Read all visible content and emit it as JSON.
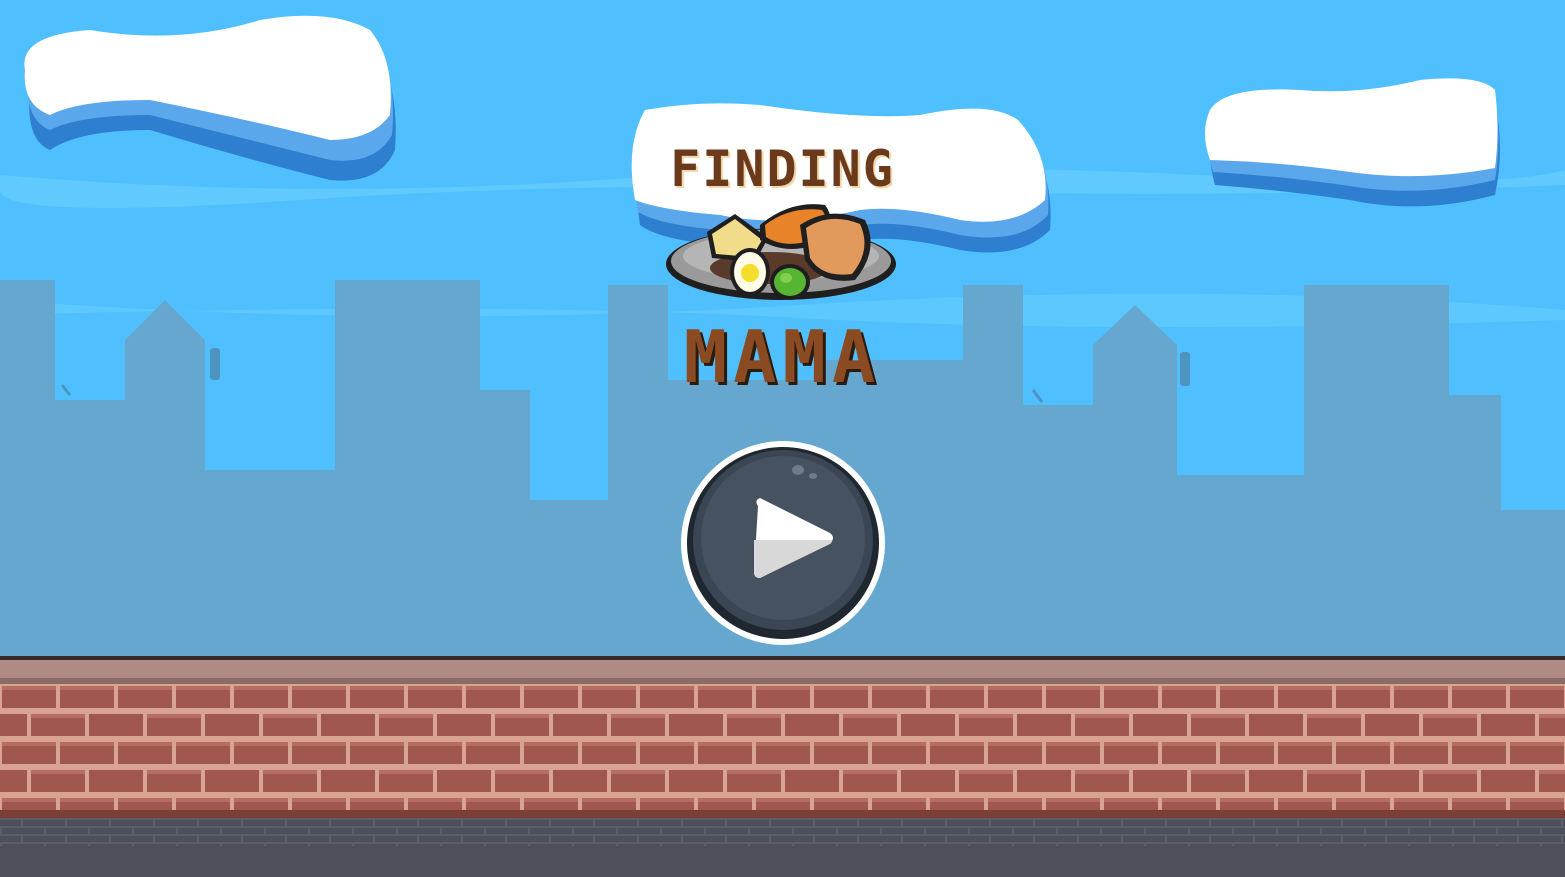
{
  "game": {
    "title_top": "FINDING",
    "title_bottom": "MAMA"
  },
  "play_button": {
    "icon": "play-icon"
  },
  "colors": {
    "sky": "#4fc0fd",
    "skyline": "#65a7cf",
    "cloud": "#ffffff",
    "cloud_shadow": "#3a8fd9",
    "brick": "#a0574d",
    "mortar": "#d9a391",
    "wall_cap": "#b08a85",
    "pavement": "#4d4f5b",
    "button_fill": "#3b4654",
    "title_brown": "#8a4a22"
  }
}
